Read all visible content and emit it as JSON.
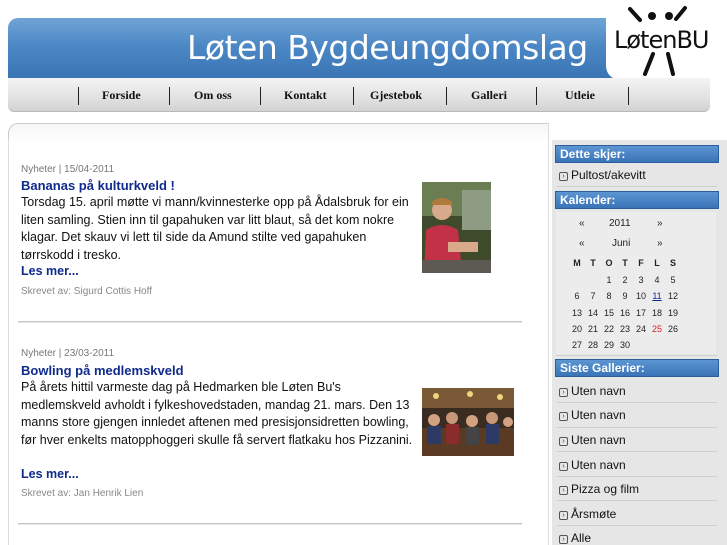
{
  "header": {
    "title": "Løten Bygdeungdomslag",
    "logo_text": "LøtenBU"
  },
  "nav": {
    "items": [
      "Forside",
      "Om oss",
      "Kontakt",
      "Gjestebok",
      "Galleri",
      "Utleie"
    ]
  },
  "posts": [
    {
      "meta": "Nyheter | 15/04-2011",
      "title": "Bananas på kulturkveld !",
      "body": "Torsdag 15. april møtte vi mann/kvinnesterke opp på Ådalsbruk for ein liten samling. Stien inn til gapahuken var litt blaut, så det kom nokre klagar. Det skauv vi lett til side da Amund stilte ved gapahuken tørrskodd i tresko.",
      "read_more": "Les mer...",
      "author": "Skrevet av: Sigurd Cottis Hoff"
    },
    {
      "meta": "Nyheter | 23/03-2011",
      "title": "Bowling på medlemskveld",
      "body": "På årets hittil varmeste dag på Hedmarken ble Løten Bu's medlemskveld avholdt i fylkeshovedstaden, mandag 21. mars. Den 13 manns store gjengen innledet aftenen med presisjonsidretten bowling, før hver enkelts matopphoggeri skulle få servert flatkaku hos Pizzanini.",
      "read_more": "Les mer...",
      "author": "Skrevet av: Jan Henrik Lien"
    }
  ],
  "sidebar": {
    "events_heading": "Dette skjer:",
    "events": [
      "Pultost/akevitt"
    ],
    "calendar_heading": "Kalender:",
    "calendar": {
      "year": "2011",
      "month": "Juni",
      "prev": "«",
      "next": "»",
      "weekdays": [
        "M",
        "T",
        "O",
        "T",
        "F",
        "L",
        "S"
      ],
      "weeks": [
        [
          "",
          "",
          "1",
          "2",
          "3",
          "4",
          "5"
        ],
        [
          "6",
          "7",
          "8",
          "9",
          "10",
          "11",
          "12"
        ],
        [
          "13",
          "14",
          "15",
          "16",
          "17",
          "18",
          "19"
        ],
        [
          "20",
          "21",
          "22",
          "23",
          "24",
          "25",
          "26"
        ],
        [
          "27",
          "28",
          "29",
          "30",
          "",
          "",
          ""
        ]
      ],
      "today": "11",
      "highlight": "25"
    },
    "galleries_heading": "Siste Gallerier:",
    "galleries": [
      "Uten navn",
      "Uten navn",
      "Uten navn",
      "Uten navn",
      "Pizza og film",
      "Årsmøte",
      "Alle"
    ]
  },
  "colors": {
    "header_blue": "#4a86c4",
    "link_blue": "#0f2a8c",
    "side_head_blue": "#3a74b8",
    "highlight_red": "#cc2222"
  }
}
